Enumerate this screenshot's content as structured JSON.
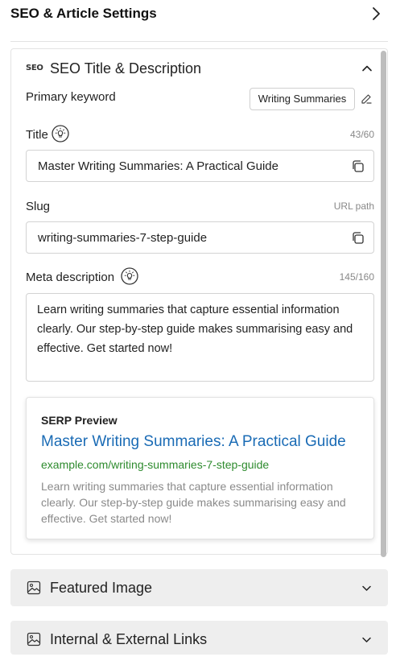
{
  "header": {
    "title": "SEO & Article Settings",
    "chevron_icon": "chevron-right-icon"
  },
  "seo_panel": {
    "icon_text": "SEO",
    "title": "SEO Title & Description",
    "collapse_icon": "chevron-up-icon",
    "primary_keyword": {
      "label": "Primary keyword",
      "value": "Writing Summaries",
      "edit_icon": "pencil-icon"
    },
    "title_field": {
      "label": "Title",
      "hint_icon": "lightbulb-icon",
      "counter": "43/60",
      "value": "Master Writing Summaries: A Practical Guide",
      "copy_icon": "copy-icon"
    },
    "slug_field": {
      "label": "Slug",
      "hint": "URL path",
      "value": "writing-summaries-7-step-guide",
      "copy_icon": "copy-icon"
    },
    "meta_field": {
      "label": "Meta description",
      "hint_icon": "lightbulb-icon",
      "counter": "145/160",
      "value": "Learn writing summaries that capture essential information clearly. Our step-by-step guide makes summarising easy and effective. Get started now!"
    },
    "serp_preview": {
      "label": "SERP Preview",
      "title": "Master Writing Summaries: A Practical Guide",
      "url": "example.com/writing-summaries-7-step-guide",
      "description": "Learn writing summaries that capture essential information clearly. Our step-by-step guide makes summarising easy and effective. Get started now!"
    }
  },
  "collapsed_sections": [
    {
      "title": "Featured Image",
      "icon": "image-icon",
      "chevron": "chevron-down-icon"
    },
    {
      "title": "Internal & External Links",
      "icon": "image-icon",
      "chevron": "chevron-down-icon"
    }
  ],
  "colors": {
    "serp_title": "#1a6bb5",
    "serp_url": "#2e8b2e",
    "serp_desc": "#8a8a8a",
    "collapsed_bg": "#eeeeee",
    "scrollbar": "#bdbdbd"
  }
}
